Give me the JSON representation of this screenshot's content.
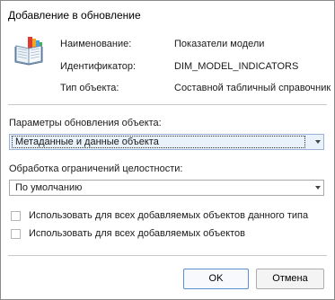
{
  "dialog": {
    "title": "Добавление в обновление"
  },
  "object_info": {
    "icon": "book-icon",
    "name_label": "Наименование:",
    "name_value": "Показатели модели",
    "id_label": "Идентификатор:",
    "id_value": "DIM_MODEL_INDICATORS",
    "type_label": "Тип объекта:",
    "type_value": "Составной табличный справочник"
  },
  "update_params": {
    "label": "Параметры обновления объекта:",
    "selected": "Метаданные и данные объекта"
  },
  "integrity": {
    "label": "Обработка ограничений целостности:",
    "selected": "По умолчанию"
  },
  "options": [
    {
      "label": "Использовать для всех добавляемых объектов данного типа",
      "checked": false
    },
    {
      "label": "Использовать для всех добавляемых объектов",
      "checked": false
    }
  ],
  "buttons": {
    "ok": "OK",
    "cancel": "Отмена"
  }
}
